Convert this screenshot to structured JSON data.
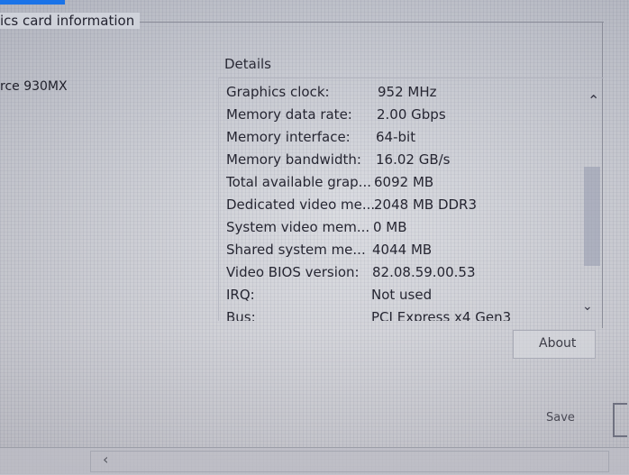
{
  "window": {
    "group_title": "ics card information"
  },
  "adapter": {
    "name": "rce 930MX"
  },
  "details": {
    "header": "Details",
    "rows": [
      {
        "label": "Graphics clock:",
        "value": "952 MHz"
      },
      {
        "label": "Memory data rate:",
        "value": "2.00 Gbps"
      },
      {
        "label": "Memory interface:",
        "value": "64-bit"
      },
      {
        "label": "Memory bandwidth:",
        "value": "16.02 GB/s"
      },
      {
        "label": "Total available grap...",
        "value": "6092 MB"
      },
      {
        "label": "Dedicated video me...",
        "value": "2048 MB DDR3"
      },
      {
        "label": "System video mem...",
        "value": "0 MB"
      },
      {
        "label": "Shared system me...",
        "value": "4044 MB"
      },
      {
        "label": "Video BIOS version:",
        "value": "82.08.59.00.53"
      },
      {
        "label": "IRQ:",
        "value": "Not used"
      },
      {
        "label": "Bus:",
        "value": "PCI Express x4 Gen3"
      }
    ]
  },
  "scroll": {
    "up_icon": "chevron-up-icon",
    "down_icon": "chevron-down-icon"
  },
  "buttons": {
    "about_label": "About",
    "save_label": "Save"
  },
  "colors": {
    "accent": "#1a73e8"
  }
}
